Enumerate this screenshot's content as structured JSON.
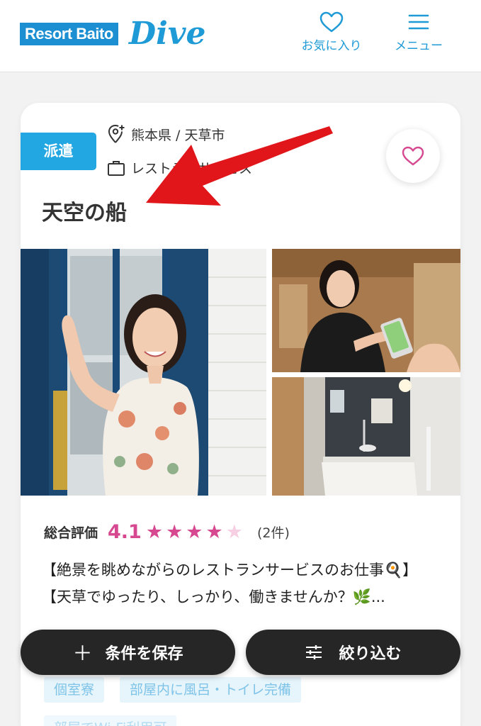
{
  "header": {
    "logo_text": "Resort Baito",
    "logo_script": "Dive",
    "favorites_label": "お気に入り",
    "menu_label": "メニュー",
    "accent_color": "#1e9ad6"
  },
  "job": {
    "badge": "派遣",
    "location": "熊本県 / 天草市",
    "category": "レストランサービス",
    "title": "天空の船",
    "rating_label": "総合評価",
    "rating_score": "4.1",
    "rating_value": 4.1,
    "rating_max": 5,
    "rating_count": "(2件)",
    "description": "【絶景を眺めながらのレストランサービスのお仕事🍳】【天草でゆったり、しっかり、働きませんか？🌿...",
    "tags": [
      "個室寮",
      "部屋内に風呂・トイレ完備",
      "部屋でWi-Fi利用可"
    ],
    "icons": [
      "location-pin-icon",
      "briefcase-icon",
      "heart-icon"
    ]
  },
  "actions": {
    "save_label": "条件を保存",
    "filter_label": "絞り込む"
  },
  "colors": {
    "badge": "#22a7e2",
    "rating": "#d6488f",
    "button_dark": "#262626",
    "annotation_arrow": "#e0161b"
  }
}
